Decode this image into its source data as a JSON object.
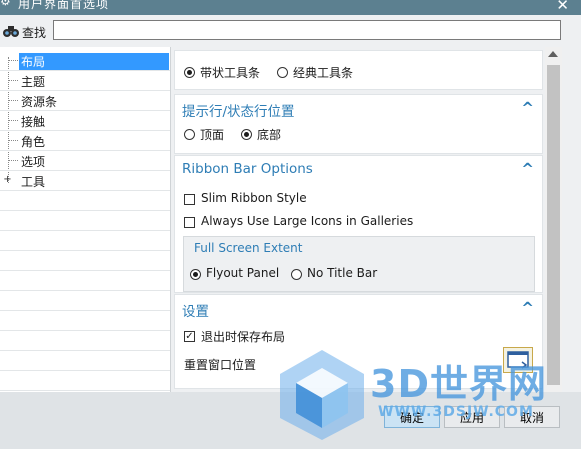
{
  "window": {
    "title": "用户界面首选项",
    "close_glyph": "✕"
  },
  "search": {
    "label": "查找",
    "value": "",
    "placeholder": ""
  },
  "tree": {
    "items": [
      {
        "label": "布局",
        "selected": true,
        "expander": ""
      },
      {
        "label": "主题",
        "selected": false,
        "expander": ""
      },
      {
        "label": "资源条",
        "selected": false,
        "expander": ""
      },
      {
        "label": "接触",
        "selected": false,
        "expander": ""
      },
      {
        "label": "角色",
        "selected": false,
        "expander": ""
      },
      {
        "label": "选项",
        "selected": false,
        "expander": ""
      },
      {
        "label": "工具",
        "selected": false,
        "expander": "+"
      }
    ]
  },
  "ribbon_style": {
    "options": [
      {
        "label": "带状工具条",
        "checked": true
      },
      {
        "label": "经典工具条",
        "checked": false
      }
    ]
  },
  "prompt_position": {
    "title": "提示行/状态行位置",
    "chevron": "^",
    "options": [
      {
        "label": "顶面",
        "checked": false
      },
      {
        "label": "底部",
        "checked": true
      }
    ]
  },
  "ribbon_bar_options": {
    "title": "Ribbon Bar Options",
    "chevron": "^",
    "slim_style": {
      "label": "Slim Ribbon Style",
      "checked": false
    },
    "large_icons": {
      "label": "Always Use Large Icons in Galleries",
      "checked": false
    },
    "full_screen": {
      "title": "Full Screen Extent",
      "options": [
        {
          "label": "Flyout Panel",
          "checked": true
        },
        {
          "label": "No Title Bar",
          "checked": false
        }
      ]
    }
  },
  "settings": {
    "title": "设置",
    "chevron": "^",
    "save_layout": {
      "label": "退出时保存布局",
      "checked": true
    },
    "reset_position": {
      "label": "重置窗口位置"
    }
  },
  "buttons": {
    "ok": "确定",
    "apply": "应用",
    "cancel": "取消"
  },
  "watermark": {
    "brand": "3D世界网",
    "url": "WWW.3DSJW.COM"
  },
  "colors": {
    "title_bar": "#5c8090",
    "accent": "#2e7db5",
    "selection": "#3399ff"
  },
  "icons": {
    "title": "gear-icon",
    "search": "binoculars-icon",
    "close": "close-icon",
    "reset": "window-layout-icon"
  }
}
